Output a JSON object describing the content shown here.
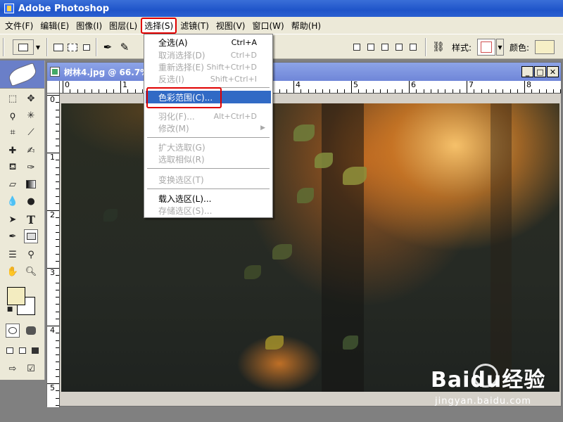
{
  "app": {
    "title": "Adobe Photoshop"
  },
  "menubar": {
    "items": [
      {
        "label": "文件(F)"
      },
      {
        "label": "编辑(E)"
      },
      {
        "label": "图像(I)"
      },
      {
        "label": "图层(L)"
      },
      {
        "label": "选择(S)",
        "active": true
      },
      {
        "label": "滤镜(T)"
      },
      {
        "label": "视图(V)"
      },
      {
        "label": "窗口(W)"
      },
      {
        "label": "帮助(H)"
      }
    ]
  },
  "options": {
    "style_label": "样式:",
    "color_label": "颜色:",
    "color_value": "#f6efc6"
  },
  "document": {
    "title": "树林4.jpg @ 66.7% (RGB)",
    "ruler_h": [
      "0",
      "1",
      "2",
      "3",
      "4",
      "5",
      "6",
      "7",
      "8"
    ],
    "ruler_v": [
      "0",
      "1",
      "2",
      "3",
      "4",
      "5"
    ]
  },
  "select_menu": {
    "items": [
      {
        "label": "全选(A)",
        "shortcut": "Ctrl+A",
        "enabled": true
      },
      {
        "label": "取消选择(D)",
        "shortcut": "Ctrl+D",
        "enabled": false
      },
      {
        "label": "重新选择(E)",
        "shortcut": "Shift+Ctrl+D",
        "enabled": false
      },
      {
        "label": "反选(I)",
        "shortcut": "Shift+Ctrl+I",
        "enabled": false
      },
      {
        "label": "色彩范围(C)...",
        "shortcut": "",
        "enabled": true,
        "highlighted": true
      },
      {
        "label": "羽化(F)...",
        "shortcut": "Alt+Ctrl+D",
        "enabled": false
      },
      {
        "label": "修改(M)",
        "shortcut": "",
        "enabled": false,
        "submenu": true
      },
      {
        "label": "扩大选取(G)",
        "shortcut": "",
        "enabled": false
      },
      {
        "label": "选取相似(R)",
        "shortcut": "",
        "enabled": false
      },
      {
        "label": "变换选区(T)",
        "shortcut": "",
        "enabled": false
      },
      {
        "label": "载入选区(L)...",
        "shortcut": "",
        "enabled": true
      },
      {
        "label": "存储选区(S)...",
        "shortcut": "",
        "enabled": false
      }
    ]
  },
  "toolbox": {
    "foreground": "#f3ecc0",
    "background": "#ffffff"
  },
  "watermark": {
    "logo": "Baidu经验",
    "url": "jingyan.baidu.com"
  },
  "colors": {
    "title_blue": "#2a5fd0",
    "menu_highlight": "#316ac5",
    "callout_red": "#e00000"
  }
}
